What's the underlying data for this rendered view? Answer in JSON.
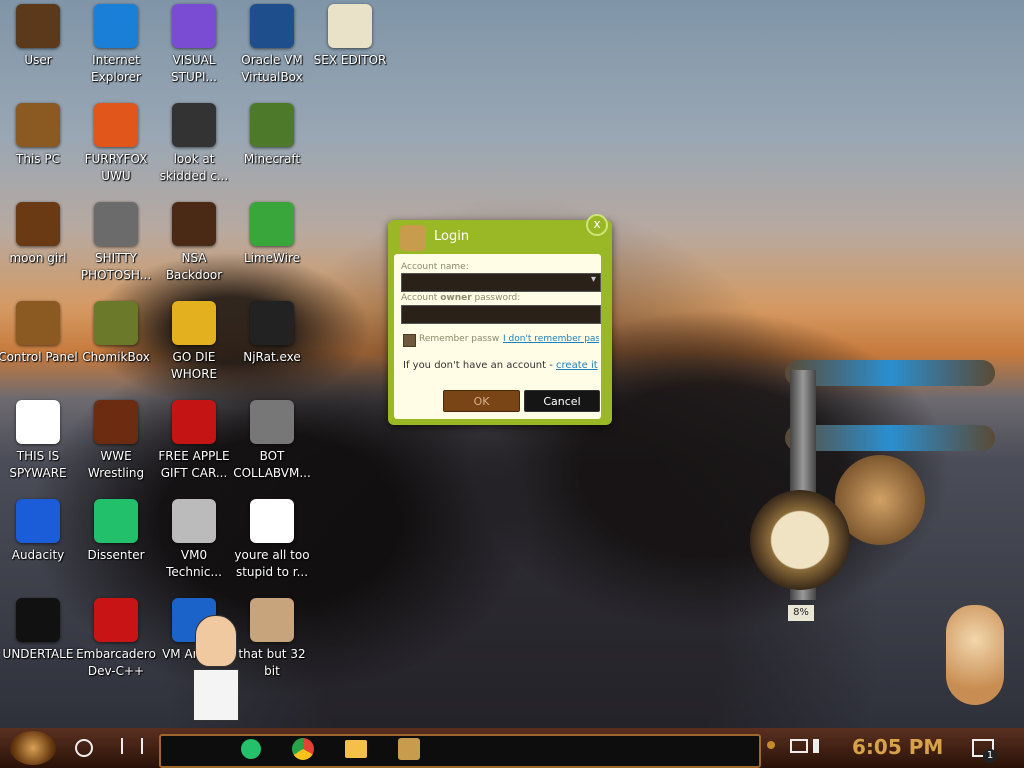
{
  "desktop": {
    "icons": [
      {
        "label": "User",
        "glyph": "user-folder-icon",
        "color": "#5a3a1a"
      },
      {
        "label": "Internet Explorer",
        "glyph": "edge-icon",
        "color": "#1a7fd6"
      },
      {
        "label": "VISUAL STUPI...",
        "glyph": "visual-studio-icon",
        "color": "#7a4bd3"
      },
      {
        "label": "Oracle VM VirtualBox",
        "glyph": "virtualbox-icon",
        "color": "#1e4f8c"
      },
      {
        "label": "SEX EDITOR",
        "glyph": "hex-editor-icon",
        "color": "#e9e2c9"
      },
      {
        "label": "This PC",
        "glyph": "computer-icon",
        "color": "#8a5a22"
      },
      {
        "label": "FURRYFOX UWU",
        "glyph": "firefox-icon",
        "color": "#e0561b"
      },
      {
        "label": "look at skidded c...",
        "glyph": "copy-windows-icon",
        "color": "#333"
      },
      {
        "label": "Minecraft",
        "glyph": "grass-block-icon",
        "color": "#4d7a2a"
      },
      {
        "label": "moon girl",
        "glyph": "book-icon",
        "color": "#6a3a15"
      },
      {
        "label": "SHITTY PHOTOSH...",
        "glyph": "gimp-icon",
        "color": "#6b6b6b"
      },
      {
        "label": "NSA Backdoor",
        "glyph": "gear-machine-icon",
        "color": "#4b2a15"
      },
      {
        "label": "LimeWire",
        "glyph": "limewire-icon",
        "color": "#39a63c"
      },
      {
        "label": "Control Panel",
        "glyph": "lightbulb-icon",
        "color": "#8a5a22"
      },
      {
        "label": "ChomikBox",
        "glyph": "hamster-icon",
        "color": "#6a7a2a"
      },
      {
        "label": "GO DIE WHORE",
        "glyph": "die-icon",
        "color": "#e3b01f"
      },
      {
        "label": "NjRat.exe",
        "glyph": "skull-icon",
        "color": "#222"
      },
      {
        "label": "THIS IS SPYWARE",
        "glyph": "chrome-icon",
        "color": "#ffffff"
      },
      {
        "label": "WWE Wrestling",
        "glyph": "arcade-icon",
        "color": "#6b2c12"
      },
      {
        "label": "FREE APPLE GIFT CAR...",
        "glyph": "apple-icon",
        "color": "#c41414"
      },
      {
        "label": "BOT COLLABVM...",
        "glyph": "monitor-icon",
        "color": "#777"
      },
      {
        "label": "Audacity",
        "glyph": "audacity-icon",
        "color": "#1b5dd8"
      },
      {
        "label": "Dissenter",
        "glyph": "dissenter-icon",
        "color": "#23c06b"
      },
      {
        "label": "VM0 Technic...",
        "glyph": "technician-icon",
        "color": "#bbb"
      },
      {
        "label": "youre all too stupid to r...",
        "glyph": "portrait-icon",
        "color": "#ffffff"
      },
      {
        "label": "UNDERTALE",
        "glyph": "unity-icon",
        "color": "#111"
      },
      {
        "label": "Embarcadero Dev-C++",
        "glyph": "devcpp-icon",
        "color": "#c81414"
      },
      {
        "label": "VM Antiv...",
        "glyph": "shield-icon",
        "color": "#1c63c9"
      },
      {
        "label": "that but 32 bit",
        "glyph": "portrait-icon",
        "color": "#c8a47d"
      }
    ]
  },
  "login": {
    "title": "Login",
    "close": "x",
    "account_name_label": "Account name:",
    "account_owner_label_pre": "Account ",
    "account_owner_label_bold": "owner",
    "account_owner_label_post": " password:",
    "remember_label": "Remember passw",
    "forgot_link": "I don't remember pas",
    "no_account_text": "If you don't have an account - ",
    "create_link": "create it",
    "ok_label": "OK",
    "cancel_label": "Cancel",
    "dropdown_caret": "▾"
  },
  "widget": {
    "gauge_percent": "8%"
  },
  "taskbar": {
    "time": "6:05 PM",
    "notification_count": "1",
    "pinned": [
      "dissenter-icon",
      "chrome-icon",
      "file-explorer-icon",
      "chomikbox-icon"
    ]
  }
}
